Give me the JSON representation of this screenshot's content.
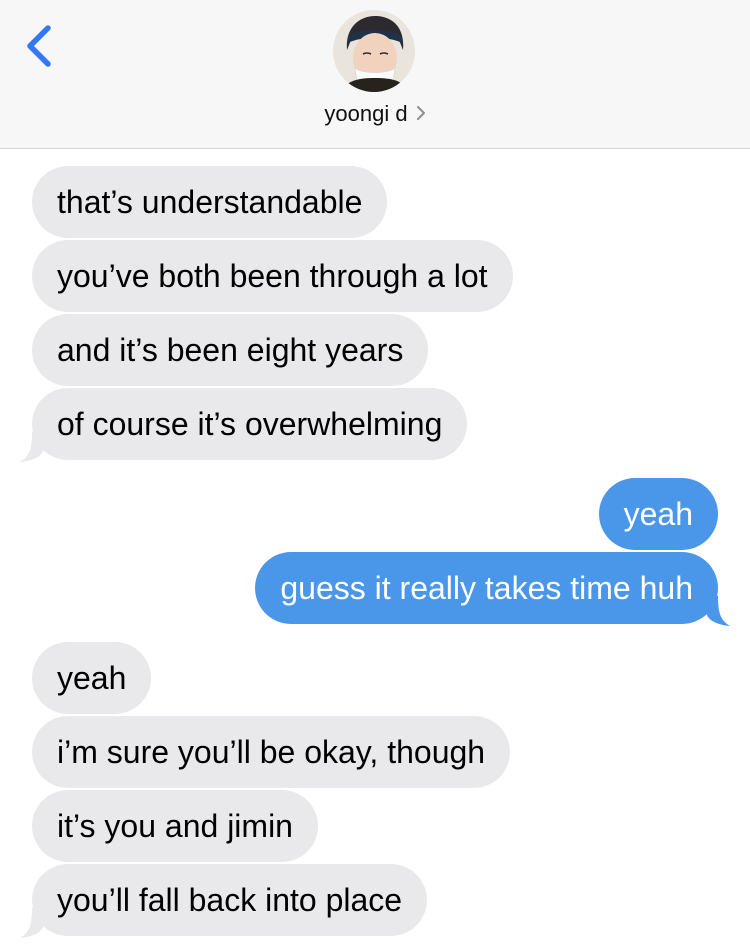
{
  "header": {
    "contact_name": "yoongi d",
    "back_icon": "chevron-left-icon",
    "detail_icon": "chevron-right-icon",
    "accent_color": "#3478f6"
  },
  "colors": {
    "incoming_bubble": "#e9e9eb",
    "outgoing_bubble": "#4a97ea",
    "header_background": "#f7f7f7"
  },
  "messages": [
    {
      "direction": "in",
      "text": "that’s understandable"
    },
    {
      "direction": "in",
      "text": "you’ve both been through a lot"
    },
    {
      "direction": "in",
      "text": "and it’s been eight years"
    },
    {
      "direction": "in",
      "text": "of course it’s overwhelming"
    },
    {
      "direction": "out",
      "text": "yeah"
    },
    {
      "direction": "out",
      "text": "guess it really takes time huh"
    },
    {
      "direction": "in",
      "text": "yeah"
    },
    {
      "direction": "in",
      "text": "i’m sure you’ll be okay, though"
    },
    {
      "direction": "in",
      "text": "it’s you and jimin"
    },
    {
      "direction": "in",
      "text": "you’ll fall back into place"
    }
  ]
}
